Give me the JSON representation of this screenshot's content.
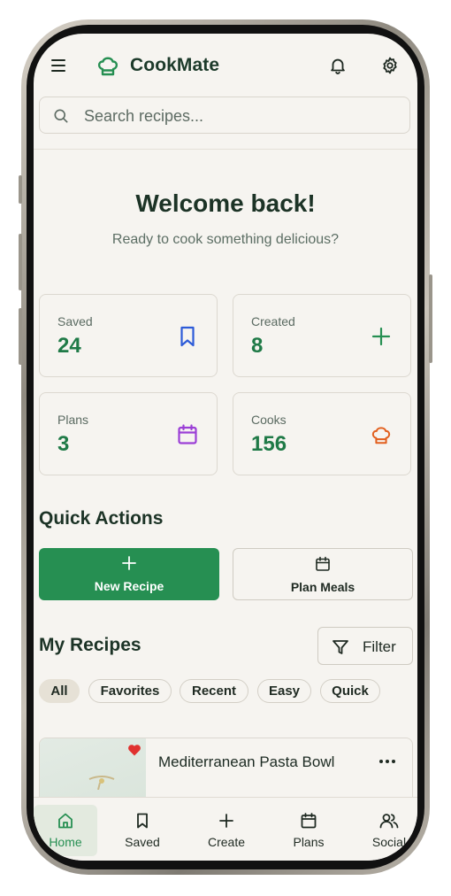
{
  "header": {
    "brand": "CookMate",
    "menu_icon": "hamburger-menu-icon",
    "logo_icon": "chef-hat-icon",
    "notifications_icon": "bell-icon",
    "settings_icon": "gear-icon"
  },
  "search": {
    "placeholder": "Search recipes..."
  },
  "welcome": {
    "title": "Welcome back!",
    "subtitle": "Ready to cook something delicious?"
  },
  "stats": [
    {
      "label": "Saved",
      "value": "24",
      "icon": "bookmark-icon",
      "color": "#2d5bd8"
    },
    {
      "label": "Created",
      "value": "8",
      "icon": "plus-icon",
      "color": "#268f52"
    },
    {
      "label": "Plans",
      "value": "3",
      "icon": "calendar-icon",
      "color": "#9b3fd6"
    },
    {
      "label": "Cooks",
      "value": "156",
      "icon": "chef-hat-icon",
      "color": "#e2601f"
    }
  ],
  "quick_actions": {
    "title": "Quick Actions",
    "items": [
      {
        "label": "New Recipe",
        "icon": "plus-icon"
      },
      {
        "label": "Plan Meals",
        "icon": "calendar-icon"
      }
    ]
  },
  "my_recipes": {
    "title": "My Recipes",
    "filter_label": "Filter",
    "chips": [
      "All",
      "Favorites",
      "Recent",
      "Easy",
      "Quick"
    ],
    "active_chip": "All",
    "recipes": [
      {
        "title": "Mediterranean Pasta Bowl",
        "favorite": true
      }
    ]
  },
  "bottom_nav": {
    "active": "Home",
    "items": [
      {
        "label": "Home",
        "icon": "home-icon"
      },
      {
        "label": "Saved",
        "icon": "bookmark-icon"
      },
      {
        "label": "Create",
        "icon": "plus-icon"
      },
      {
        "label": "Plans",
        "icon": "calendar-icon"
      },
      {
        "label": "Social",
        "icon": "users-icon"
      }
    ]
  },
  "colors": {
    "brand_green": "#268f52",
    "background": "#f6f4f0",
    "heading": "#1c3326",
    "favorite_red": "#e0312f"
  }
}
